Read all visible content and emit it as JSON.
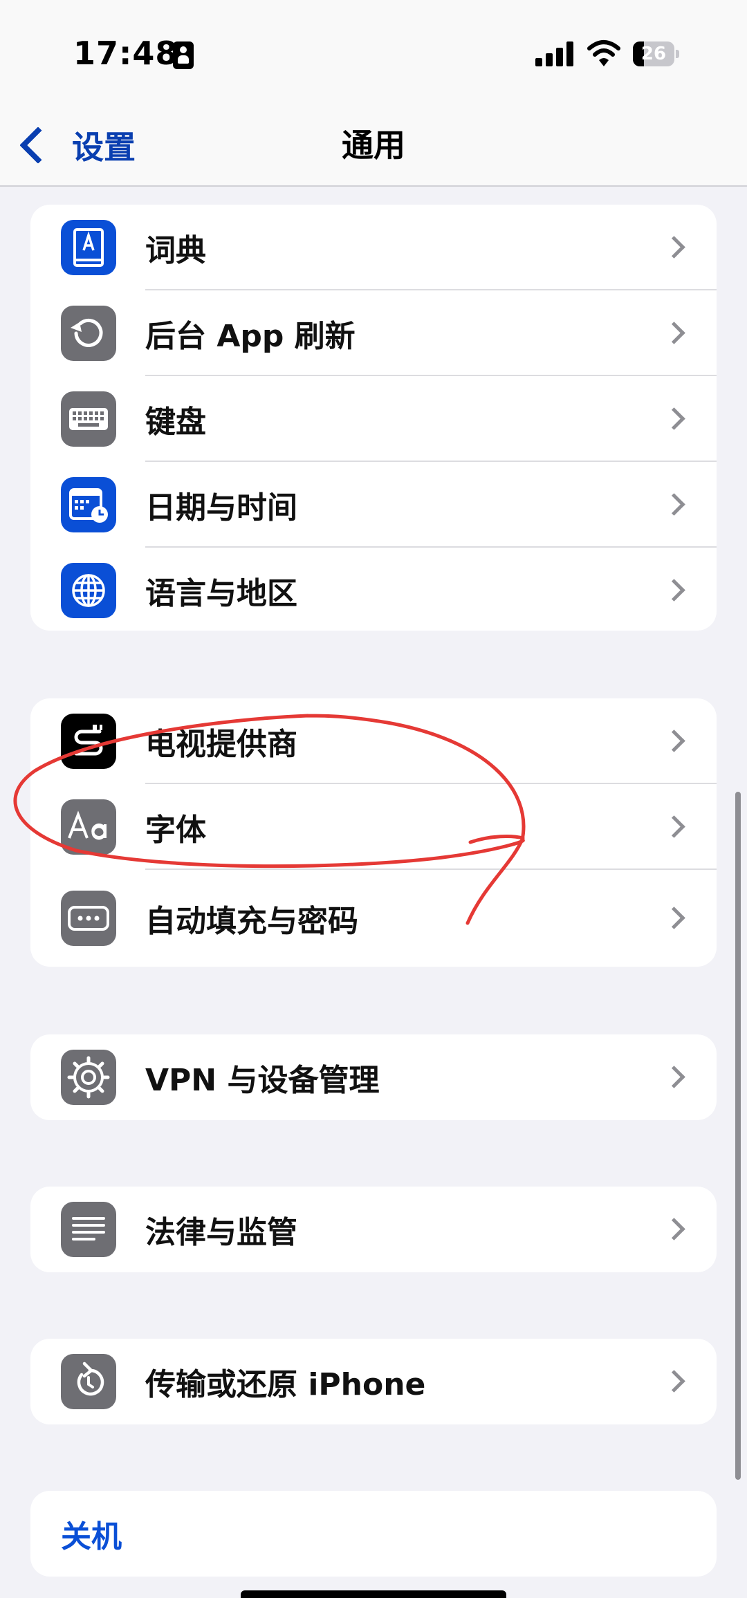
{
  "status_bar": {
    "time": "17:48",
    "battery_level": "26",
    "battery_fraction": 0.26
  },
  "nav": {
    "back_label": "设置",
    "title": "通用"
  },
  "groups": [
    {
      "items": [
        {
          "label": "词典",
          "icon": "dictionary-icon",
          "icon_color": "#0a4fd6"
        },
        {
          "label": "后台 App 刷新",
          "icon": "background-refresh-icon",
          "icon_color": "#6e6e73"
        },
        {
          "label": "键盘",
          "icon": "keyboard-icon",
          "icon_color": "#6e6e73"
        },
        {
          "label": "日期与时间",
          "icon": "calendar-clock-icon",
          "icon_color": "#0a4fd6"
        },
        {
          "label": "语言与地区",
          "icon": "globe-icon",
          "icon_color": "#0a4fd6"
        }
      ]
    },
    {
      "items": [
        {
          "label": "电视提供商",
          "icon": "tv-provider-icon",
          "icon_color": "#000000"
        },
        {
          "label": "字体",
          "icon": "font-icon",
          "icon_color": "#6e6e73"
        },
        {
          "label": "自动填充与密码",
          "icon": "password-key-icon",
          "icon_color": "#6e6e73"
        }
      ]
    },
    {
      "items": [
        {
          "label": "VPN 与设备管理",
          "icon": "gear-icon",
          "icon_color": "#6e6e73"
        }
      ]
    },
    {
      "items": [
        {
          "label": "法律与监管",
          "icon": "document-lines-icon",
          "icon_color": "#6e6e73"
        }
      ]
    },
    {
      "items": [
        {
          "label": "传输或还原 iPhone",
          "icon": "reset-icon",
          "icon_color": "#6e6e73"
        }
      ]
    },
    {
      "items": [
        {
          "label": "关机"
        }
      ]
    }
  ],
  "annotation_color": "#e53935",
  "accent_color": "#0a4fd6"
}
